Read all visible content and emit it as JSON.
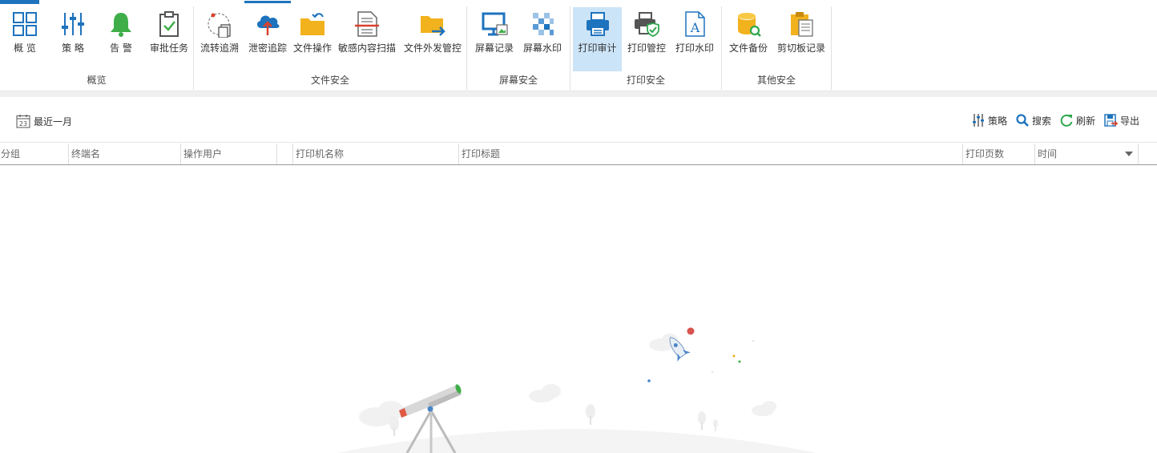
{
  "colors": {
    "accent": "#1e73be",
    "active_bg": "#cce4f7",
    "bell_green": "#3fae49",
    "folder_yellow": "#f2b21d",
    "shield_green": "#2fa84f",
    "red_arrow": "#d9412b"
  },
  "ribbon": {
    "groups": [
      {
        "label": "概览",
        "buttons": [
          {
            "label": "概 览",
            "icon": "grid-icon"
          },
          {
            "label": "策 略",
            "icon": "sliders-icon"
          },
          {
            "label": "告 警",
            "icon": "bell-icon"
          },
          {
            "label": "审批任务",
            "icon": "clipboard-check-icon"
          }
        ]
      },
      {
        "label": "文件安全",
        "buttons": [
          {
            "label": "流转追溯",
            "icon": "file-trace-icon"
          },
          {
            "label": "泄密追踪",
            "icon": "cloud-upload-icon"
          },
          {
            "label": "文件操作",
            "icon": "folder-icon"
          },
          {
            "label": "敏感内容扫描",
            "icon": "document-scan-icon"
          },
          {
            "label": "文件外发管控",
            "icon": "folder-send-icon"
          }
        ]
      },
      {
        "label": "屏幕安全",
        "buttons": [
          {
            "label": "屏幕记录",
            "icon": "monitor-icon"
          },
          {
            "label": "屏幕水印",
            "icon": "checker-icon"
          }
        ]
      },
      {
        "label": "打印安全",
        "buttons": [
          {
            "label": "打印审计",
            "icon": "printer-icon"
          },
          {
            "label": "打印管控",
            "icon": "printer-shield-icon"
          },
          {
            "label": "打印水印",
            "icon": "document-a-icon"
          }
        ]
      },
      {
        "label": "其他安全",
        "buttons": [
          {
            "label": "文件备份",
            "icon": "database-search-icon"
          },
          {
            "label": "剪切板记录",
            "icon": "clipboard-icon"
          }
        ]
      }
    ]
  },
  "toolbar": {
    "date_range": "最近一月",
    "calendar_day": "23",
    "actions": [
      {
        "label": "策略",
        "icon": "sliders-small-icon"
      },
      {
        "label": "搜索",
        "icon": "search-icon"
      },
      {
        "label": "刷新",
        "icon": "refresh-icon"
      },
      {
        "label": "导出",
        "icon": "export-icon"
      }
    ]
  },
  "table": {
    "columns": [
      "分组",
      "终端名",
      "操作用户",
      "",
      "打印机名称",
      "打印标题",
      "打印页数",
      "时间"
    ]
  }
}
